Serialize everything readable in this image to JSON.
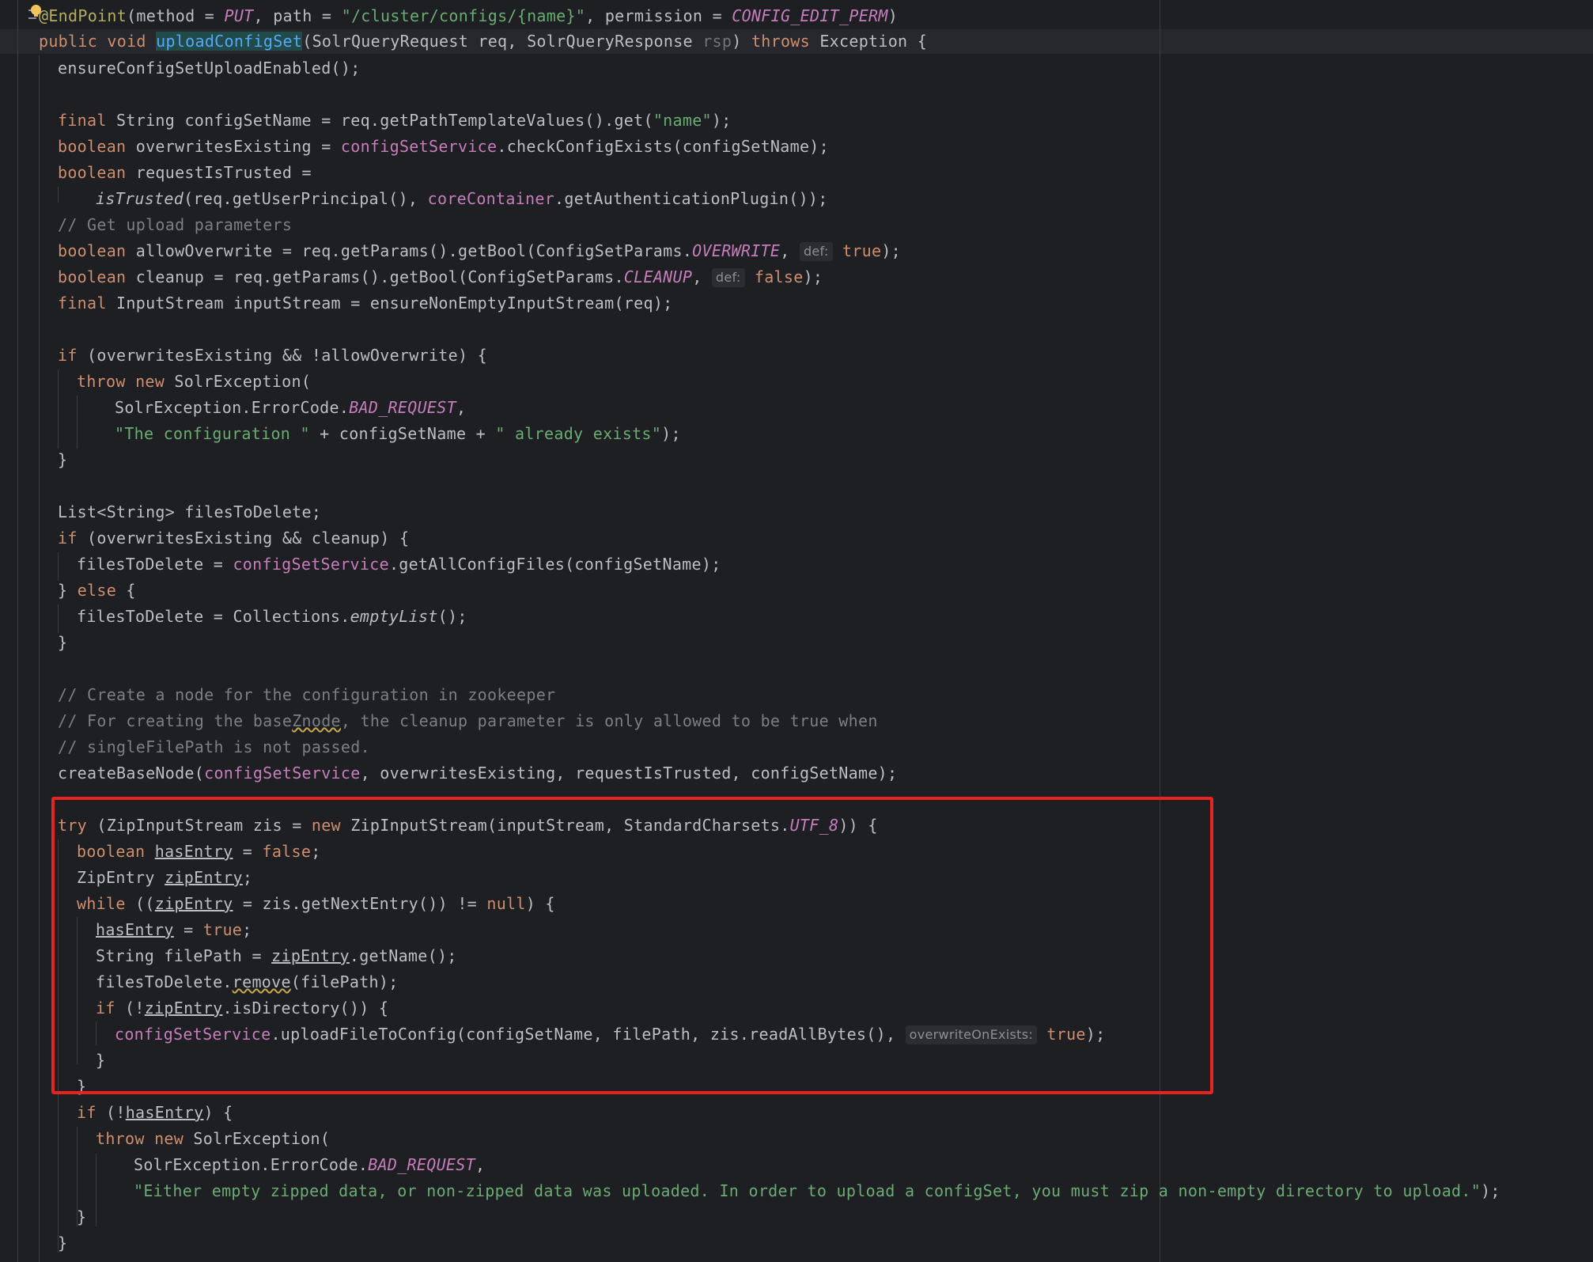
{
  "editor": {
    "lines": [
      [
        "@EndPoint",
        "(method = ",
        "PUT",
        ", path = ",
        "\"/cluster/configs/{name}\"",
        ", permission = ",
        "CONFIG_EDIT_PERM",
        ")"
      ],
      [
        "public",
        " ",
        "void",
        " ",
        "uploadConfigSet",
        "(SolrQueryRequest req, SolrQueryResponse ",
        "rsp",
        ") ",
        "throws",
        " Exception {"
      ],
      [
        "ensureConfigSetUploadEnabled();"
      ],
      [
        "final",
        " String configSetName = req.getPathTemplateValues().get(",
        "\"name\"",
        ");"
      ],
      [
        "boolean",
        " overwritesExisting = ",
        "configSetService",
        ".checkConfigExists(configSetName);"
      ],
      [
        "boolean",
        " requestIsTrusted ="
      ],
      [
        "isTrusted",
        "(req.getUserPrincipal(), ",
        "coreContainer",
        ".getAuthenticationPlugin());"
      ],
      [
        "// Get upload parameters"
      ],
      [
        "boolean",
        " allowOverwrite = req.getParams().getBool(ConfigSetParams.",
        "OVERWRITE",
        ", ",
        "def:",
        " ",
        "true",
        ");"
      ],
      [
        "boolean",
        " cleanup = req.getParams().getBool(ConfigSetParams.",
        "CLEANUP",
        ", ",
        "def:",
        " ",
        "false",
        ");"
      ],
      [
        "final",
        " InputStream inputStream = ensureNonEmptyInputStream(req);"
      ],
      [
        "if",
        " (overwritesExisting && !allowOverwrite) {"
      ],
      [
        "throw",
        " ",
        "new",
        " SolrException("
      ],
      [
        "SolrException.ErrorCode.",
        "BAD_REQUEST",
        ","
      ],
      [
        "\"The configuration \"",
        " + configSetName + ",
        "\" already exists\"",
        ");"
      ],
      [
        "}"
      ],
      [
        "List<String> filesToDelete;"
      ],
      [
        "if",
        " (overwritesExisting && cleanup) {"
      ],
      [
        "filesToDelete = ",
        "configSetService",
        ".getAllConfigFiles(configSetName);"
      ],
      [
        "} ",
        "else",
        " {"
      ],
      [
        "filesToDelete = Collections.",
        "emptyList",
        "();"
      ],
      [
        "}"
      ],
      [
        "// Create a node for the configuration in zookeeper"
      ],
      [
        "// For creating the base",
        "Znode",
        ", the cleanup parameter is only allowed to be true when"
      ],
      [
        "// singleFilePath is not passed."
      ],
      [
        "createBaseNode(",
        "configSetService",
        ", overwritesExisting, requestIsTrusted, configSetName);"
      ],
      [
        "try",
        " (ZipInputStream zis = ",
        "new",
        " ZipInputStream(inputStream, StandardCharsets.",
        "UTF_8",
        ")) {"
      ],
      [
        "boolean",
        " ",
        "hasEntry",
        " = ",
        "false",
        ";"
      ],
      [
        "ZipEntry ",
        "zipEntry",
        ";"
      ],
      [
        "while",
        " ((",
        "zipEntry",
        " = zis.getNextEntry()) != ",
        "null",
        ") {"
      ],
      [
        "hasEntry",
        " = ",
        "true",
        ";"
      ],
      [
        "String filePath = ",
        "zipEntry",
        ".getName();"
      ],
      [
        "filesToDelete.",
        "remove",
        "(filePath);"
      ],
      [
        "if",
        " (!",
        "zipEntry",
        ".isDirectory()) {"
      ],
      [
        "configSetService",
        ".uploadFileToConfig(configSetName, filePath, zis.readAllBytes(), ",
        "overwriteOnExists:",
        " ",
        "true",
        ");"
      ],
      [
        "}"
      ],
      [
        "}"
      ],
      [
        "if",
        " (!",
        "hasEntry",
        ") {"
      ],
      [
        "throw",
        " ",
        "new",
        " SolrException("
      ],
      [
        "SolrException.ErrorCode.",
        "BAD_REQUEST",
        ","
      ],
      [
        "\"Either empty zipped data, or non-zipped data was uploaded. In order to upload a configSet, you must zip a non-empty directory to upload.\"",
        ");"
      ],
      [
        "}"
      ],
      [
        "}"
      ]
    ]
  },
  "colors": {
    "background": "#1e1f22",
    "keyword": "#cf8e6d",
    "string": "#6aab73",
    "comment": "#7a7e85",
    "field": "#c77dbb",
    "annotation": "#b3ae60",
    "highlight_box": "#e6231f"
  },
  "icons": {
    "intention": "lightbulb-icon",
    "fold": "fold-icon"
  }
}
